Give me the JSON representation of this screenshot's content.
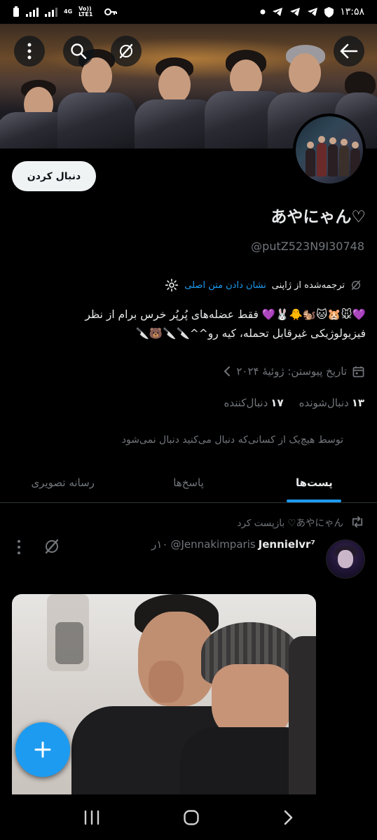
{
  "status_bar": {
    "time": "۱۳:۵۸",
    "network_label": "4G",
    "volte_label": "Vo)) LTE1",
    "left_icons": [
      "battery-icon",
      "signal-icon",
      "signal-icon",
      "network-icon",
      "key-icon"
    ],
    "right_icons": [
      "dot-icon",
      "telegram-icon",
      "telegram-icon",
      "telegram-icon",
      "shield-icon"
    ]
  },
  "banner": {
    "buttons": [
      "back-arrow-icon",
      "grok-icon",
      "search-icon",
      "more-vertical-icon"
    ]
  },
  "profile": {
    "follow_label": "دنبال کردن",
    "name": "あやにゃん♡",
    "handle": "@putZ523N9I30748",
    "translated_from": "ترجمه‌شده از ژاپنی",
    "show_original": "نشان دادن متن اصلی",
    "bio_line1": "💜🐭🐹🐱🐿️🐥🐰💜 فقط عضله‌های پُرپُر خرس برام از نظر",
    "bio_line2": "فیزیولوژیکی غیرقابل تحمله، کیه رو^^🔪🔪🐻🔪",
    "joined": "تاریخ پیوستن: ژوئیهٔ ۲۰۲۴",
    "following_count": "۱۳",
    "following_label": "دنبال‌شونده",
    "followers_count": "۱۷",
    "followers_label": "دنبال‌کننده",
    "followers_note": "توسط هیچ‌یک از کسانی‌که دنبال می‌کنید دنبال نمی‌شود"
  },
  "tabs": [
    {
      "label": "پست‌ها",
      "active": true
    },
    {
      "label": "پاسخ‌ها",
      "active": false
    },
    {
      "label": "رسانه تصویری",
      "active": false
    }
  ],
  "tweet": {
    "repost_text": "あやにゃん♡ بازپست کرد",
    "author_name": "Jennielvr⁷",
    "author_handle": "@Jennakimparis",
    "time": "۱۰ر"
  },
  "colors": {
    "accent": "#1d9bf0",
    "background": "#000000",
    "text_primary": "#e7e9ea",
    "text_secondary": "#71767b"
  }
}
